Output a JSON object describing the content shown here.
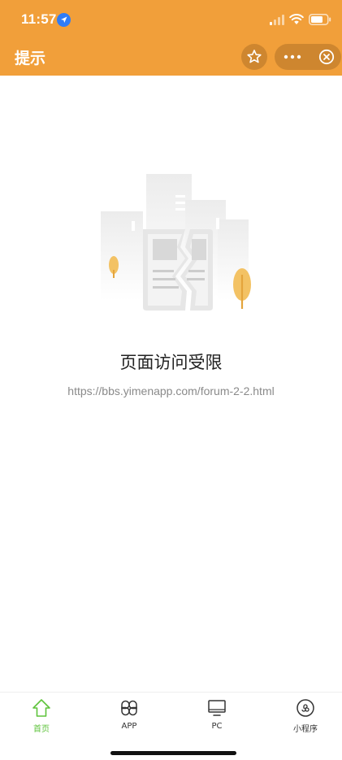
{
  "status_bar": {
    "time": "11:57",
    "icons": [
      "location-icon",
      "signal-icon",
      "wifi-icon",
      "battery-icon"
    ]
  },
  "header": {
    "title": "提示",
    "background_color": "#f19f3a",
    "buttons": [
      "star-icon",
      "more-icon",
      "close-icon"
    ]
  },
  "main": {
    "illustration": "broken-page-icon",
    "title": "页面访问受限",
    "url": "https://bbs.yimenapp.com/forum-2-2.html"
  },
  "tabbar": {
    "active_color": "#5ec33b",
    "tabs": [
      {
        "label": "首页",
        "icon": "home-icon",
        "active": true
      },
      {
        "label": "APP",
        "icon": "app-grid-icon",
        "active": false
      },
      {
        "label": "PC",
        "icon": "monitor-icon",
        "active": false
      },
      {
        "label": "小程序",
        "icon": "mini-program-icon",
        "active": false
      }
    ]
  }
}
